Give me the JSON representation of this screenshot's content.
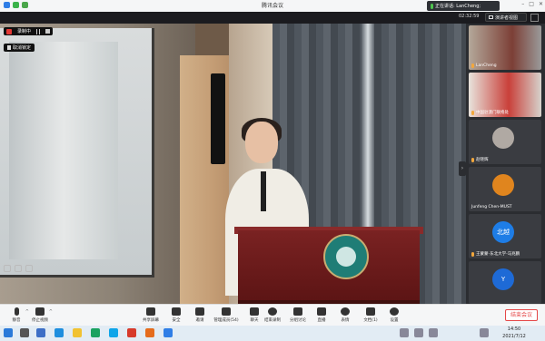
{
  "window": {
    "title": "腾讯会议"
  },
  "header": {
    "speaking_label": "正在讲话: LanCheng;",
    "elapsed": "02:32:59",
    "view_button": "演讲者视图"
  },
  "stage": {
    "rec_label": "录制中",
    "cancel_label": "取消锁定"
  },
  "participants": [
    {
      "name": "LanCheng"
    },
    {
      "name": "中国驻澳门联络处"
    },
    {
      "name": "赵晓辉"
    },
    {
      "name": "Junfeng Chen-MUST"
    },
    {
      "name": "王蒙蒙-东北大学-马兆鹏",
      "avatar": "北越",
      "color": "#1e7de6"
    },
    {
      "name": "",
      "avatar": "Y",
      "color": "#1e6ad6"
    }
  ],
  "toolbar": {
    "mute": "静音",
    "stop_video": "停止视频",
    "share": "共享屏幕",
    "security": "安全",
    "invite": "邀请",
    "manage": "管理成员(54)",
    "chat": "聊天",
    "record": "结束录制",
    "breakout": "分组讨论",
    "apps": "直播",
    "react": "表情",
    "notes": "文档(1)",
    "settings": "设置",
    "end": "结束会议"
  },
  "taskbar": {
    "time": "14:50",
    "date": "2021/7/12"
  },
  "colors": {
    "accent": "#1e7de6",
    "danger": "#e54848"
  }
}
